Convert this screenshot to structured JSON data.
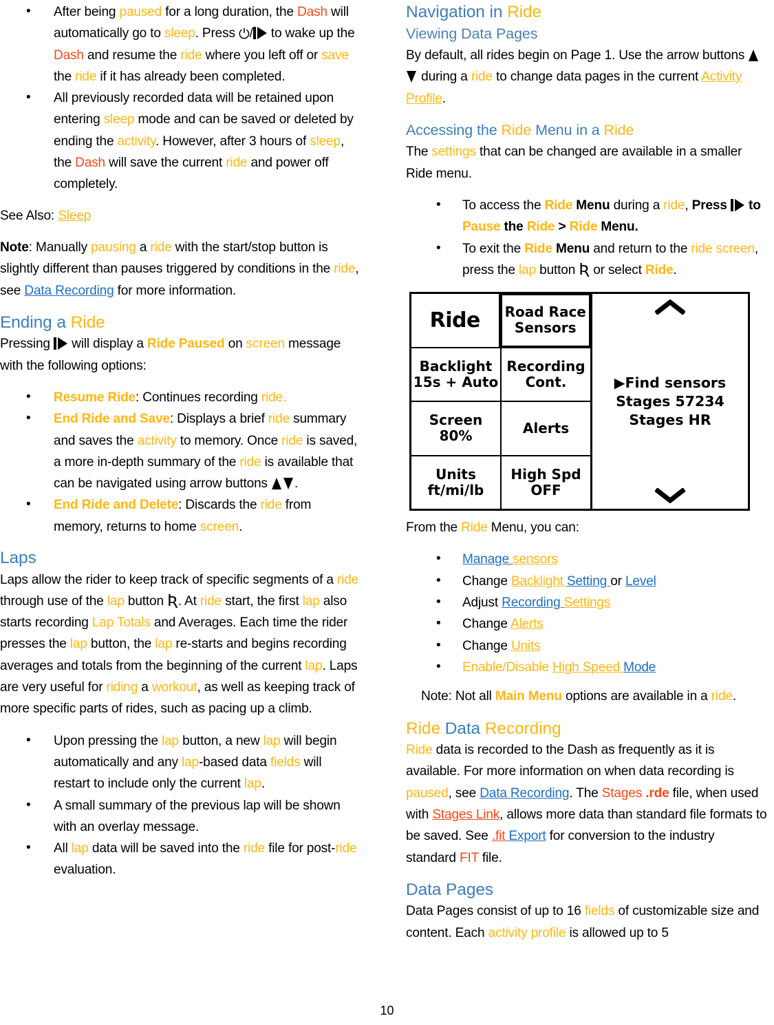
{
  "page": {
    "number": "10"
  },
  "colors": {
    "orange": "#ffb612",
    "red": "#fa4616",
    "blue_heading": "#3d7ebd",
    "blue_link": "#1f6fc4"
  },
  "left_column": {
    "bullets_top": [
      {
        "parts": [
          {
            "t": "After being ",
            "s": "plain"
          },
          {
            "t": "paused",
            "s": "orange"
          },
          {
            "t": " for a long duration, the ",
            "s": "plain"
          },
          {
            "t": "Dash",
            "s": "red"
          },
          {
            "t": " will automatically go to ",
            "s": "plain"
          },
          {
            "t": "sleep",
            "s": "orange"
          },
          {
            "t": ". Press ",
            "s": "plain"
          },
          {
            "t": "[power]/[playpause]",
            "s": "icon"
          },
          {
            "t": " to wake up the ",
            "s": "plain"
          },
          {
            "t": "Dash",
            "s": "red"
          },
          {
            "t": " and resume the ",
            "s": "plain"
          },
          {
            "t": "ride",
            "s": "orange"
          },
          {
            "t": " where you left off or ",
            "s": "plain"
          },
          {
            "t": "save",
            "s": "orange"
          },
          {
            "t": " the ",
            "s": "plain"
          },
          {
            "t": "ride",
            "s": "orange"
          },
          {
            "t": " if it has already been completed.",
            "s": "plain"
          }
        ]
      },
      {
        "parts": [
          {
            "t": "All previously recorded data will be retained upon entering ",
            "s": "plain"
          },
          {
            "t": "sleep",
            "s": "orange"
          },
          {
            "t": " mode and can be saved or deleted by ending the ",
            "s": "plain"
          },
          {
            "t": "activity",
            "s": "orange"
          },
          {
            "t": ". However, after 3 hours of ",
            "s": "plain"
          },
          {
            "t": "sleep",
            "s": "orange"
          },
          {
            "t": ", the ",
            "s": "plain"
          },
          {
            "t": "Dash",
            "s": "red"
          },
          {
            "t": " will save the current ",
            "s": "plain"
          },
          {
            "t": "ride",
            "s": "orange"
          },
          {
            "t": " and power off completely.",
            "s": "plain"
          }
        ]
      }
    ],
    "see_also_prefix": "See Also: ",
    "see_also_link": "Sleep",
    "note_label": "Note",
    "note_text_1": ": Manually ",
    "note_pausing": "pausing",
    "note_text_2": " a ",
    "note_ride": "ride",
    "note_text_3": " with the start/stop button is slightly different than pauses triggered by conditions in the ",
    "note_ride2": "ride",
    "note_text_4": ", see ",
    "note_link": "Data Recording",
    "note_text_5": " for more information.",
    "ending_heading_a": "Ending a ",
    "ending_heading_b": "Ride",
    "ending_text_1": "Pressing ",
    "ending_text_2": " will display a ",
    "ending_bold": "Ride Paused",
    "ending_text_3": " on ",
    "ending_screen": "screen",
    "ending_text_4": " message with the following options:",
    "ending_bullets": [
      {
        "bold_label": "Resume Ride",
        "parts": [
          {
            "t": ": Continues recording ",
            "s": "plain"
          },
          {
            "t": "ride.",
            "s": "orange"
          }
        ]
      },
      {
        "bold_label": "End Ride and Save",
        "parts": [
          {
            "t": ": Displays a brief ",
            "s": "plain"
          },
          {
            "t": "ride",
            "s": "orange"
          },
          {
            "t": " summary and saves the ",
            "s": "plain"
          },
          {
            "t": "activity",
            "s": "orange"
          },
          {
            "t": " to memory. Once ",
            "s": "plain"
          },
          {
            "t": "ride",
            "s": "orange"
          },
          {
            "t": " is saved, a more in-depth summary of the ",
            "s": "plain"
          },
          {
            "t": "ride",
            "s": "orange"
          },
          {
            "t": " is available that can be navigated using arrow buttons ",
            "s": "plain"
          },
          {
            "t": "[up][down]",
            "s": "icon"
          },
          {
            "t": ".",
            "s": "plain"
          }
        ]
      },
      {
        "bold_label": "End Ride and Delete",
        "parts": [
          {
            "t": ": Discards the ",
            "s": "plain"
          },
          {
            "t": "ride",
            "s": "orange"
          },
          {
            "t": " from memory, returns to home ",
            "s": "plain"
          },
          {
            "t": "screen",
            "s": "orange"
          },
          {
            "t": ".",
            "s": "plain"
          }
        ]
      }
    ],
    "laps_heading": "Laps",
    "laps_paragraph": [
      {
        "t": "Laps allow the rider to keep track of specific segments of a ",
        "s": "plain"
      },
      {
        "t": "ride",
        "s": "orange"
      },
      {
        "t": " through use of the ",
        "s": "plain"
      },
      {
        "t": "lap",
        "s": "orange"
      },
      {
        "t": " button ",
        "s": "plain"
      },
      {
        "t": "[lap]",
        "s": "icon"
      },
      {
        "t": ". At ",
        "s": "plain"
      },
      {
        "t": "ride",
        "s": "orange"
      },
      {
        "t": " start, the first ",
        "s": "plain"
      },
      {
        "t": "lap",
        "s": "orange"
      },
      {
        "t": " also starts recording ",
        "s": "plain"
      },
      {
        "t": "Lap Totals",
        "s": "orange"
      },
      {
        "t": " and Averages. Each time the rider presses the ",
        "s": "plain"
      },
      {
        "t": "lap",
        "s": "orange"
      },
      {
        "t": " button, the ",
        "s": "plain"
      },
      {
        "t": "lap",
        "s": "orange"
      },
      {
        "t": " re-starts and begins recording averages and totals from the beginning of the current ",
        "s": "plain"
      },
      {
        "t": "lap",
        "s": "orange"
      },
      {
        "t": ". Laps are very useful for ",
        "s": "plain"
      },
      {
        "t": "riding",
        "s": "orange"
      },
      {
        "t": " a ",
        "s": "plain"
      },
      {
        "t": "workout",
        "s": "orange"
      },
      {
        "t": ", as well as keeping track of more specific parts of rides, such as pacing up a climb.",
        "s": "plain"
      }
    ],
    "laps_bullets": [
      {
        "parts": [
          {
            "t": "Upon pressing the ",
            "s": "plain"
          },
          {
            "t": "lap",
            "s": "orange"
          },
          {
            "t": " button, a new ",
            "s": "plain"
          },
          {
            "t": "lap",
            "s": "orange"
          },
          {
            "t": " will begin automatically and any ",
            "s": "plain"
          },
          {
            "t": "lap",
            "s": "orange"
          },
          {
            "t": "-based data ",
            "s": "plain"
          },
          {
            "t": "fields",
            "s": "orange"
          },
          {
            "t": " will restart to include only the current ",
            "s": "plain"
          },
          {
            "t": "lap",
            "s": "orange"
          },
          {
            "t": ".",
            "s": "plain"
          }
        ]
      },
      {
        "parts": [
          {
            "t": "A small summary of the previous lap will be shown with an overlay message.",
            "s": "plain"
          }
        ]
      },
      {
        "parts": [
          {
            "t": "All ",
            "s": "plain"
          },
          {
            "t": "lap",
            "s": "orange"
          },
          {
            "t": " data will be saved into the ",
            "s": "plain"
          },
          {
            "t": "ride",
            "s": "orange"
          },
          {
            "t": " file for post-",
            "s": "plain"
          },
          {
            "t": "ride",
            "s": "orange"
          },
          {
            "t": " evaluation.",
            "s": "plain"
          }
        ]
      }
    ]
  },
  "right_column": {
    "nav_heading_a": "Navigation in ",
    "nav_heading_b": "Ride",
    "viewing_heading": "Viewing Data Pages",
    "viewing_text_1": "By default, all rides begin on Page 1. Use the arrow buttons ",
    "viewing_text_2": " during a ",
    "viewing_ride": "ride",
    "viewing_text_3": " to change data pages in the current ",
    "viewing_link": "Activity Profile",
    "viewing_text_4": ".",
    "accessing_heading": [
      {
        "t": "Accessing the ",
        "s": "blue"
      },
      {
        "t": "Ride",
        "s": "orange"
      },
      {
        "t": " Menu in a ",
        "s": "blue"
      },
      {
        "t": "Ride",
        "s": "orange"
      }
    ],
    "accessing_text_1": "The ",
    "accessing_settings": "settings",
    "accessing_text_2": " that can be changed are available in a smaller Ride menu.",
    "access_bullets": [
      {
        "parts": [
          {
            "t": "To access the ",
            "s": "plain"
          },
          {
            "t": "Ride",
            "s": "orange-bold"
          },
          {
            "t": " Menu",
            "s": "bold"
          },
          {
            "t": " during a ",
            "s": "plain"
          },
          {
            "t": "ride",
            "s": "orange"
          },
          {
            "t": ", ",
            "s": "plain"
          },
          {
            "t": "Press ",
            "s": "bold"
          },
          {
            "t": "[playpause]",
            "s": "icon"
          },
          {
            "t": " to ",
            "s": "bold"
          },
          {
            "t": "Pause",
            "s": "orange-bold"
          },
          {
            "t": " the ",
            "s": "bold"
          },
          {
            "t": "Ride",
            "s": "orange-bold"
          },
          {
            "t": " > ",
            "s": "bold"
          },
          {
            "t": "Ride",
            "s": "orange-bold"
          },
          {
            "t": " Menu.",
            "s": "bold"
          }
        ]
      },
      {
        "parts": [
          {
            "t": "To exit the ",
            "s": "plain"
          },
          {
            "t": "Ride",
            "s": "orange-bold"
          },
          {
            "t": " Menu",
            "s": "bold"
          },
          {
            "t": " and return to the ",
            "s": "plain"
          },
          {
            "t": "ride screen",
            "s": "orange"
          },
          {
            "t": ", press the ",
            "s": "plain"
          },
          {
            "t": "lap",
            "s": "orange"
          },
          {
            "t": " button ",
            "s": "plain"
          },
          {
            "t": "[lap]",
            "s": "icon"
          },
          {
            "t": " or select ",
            "s": "plain"
          },
          {
            "t": "Ride",
            "s": "orange-bold"
          },
          {
            "t": ".",
            "s": "plain"
          }
        ]
      }
    ],
    "device_screen": {
      "rows": [
        [
          {
            "label": "Ride",
            "value": "",
            "selected": false,
            "title": true
          },
          {
            "label": "Road Race",
            "value": "Sensors",
            "selected": true,
            "title": false
          }
        ],
        [
          {
            "label": "Backlight",
            "value": "15s + Auto",
            "selected": false,
            "title": false
          },
          {
            "label": "Recording",
            "value": "Cont.",
            "selected": false,
            "title": false
          }
        ],
        [
          {
            "label": "Screen",
            "value": "80%",
            "selected": false,
            "title": false
          },
          {
            "label": "Alerts",
            "value": "",
            "selected": false,
            "title": false
          }
        ],
        [
          {
            "label": "Units",
            "value": "ft/mi/lb",
            "selected": false,
            "title": false
          },
          {
            "label": "High Spd",
            "value": "OFF",
            "selected": false,
            "title": false
          }
        ]
      ],
      "panel_lines": [
        "▶Find sensors",
        "Stages 57234",
        "Stages HR"
      ],
      "scroll_up_icon": "chevron-up-icon",
      "scroll_down_icon": "chevron-down-icon"
    },
    "from_menu_text_1": "From the ",
    "from_menu_ride": "Ride",
    "from_menu_text_2": " Menu, you can:",
    "menu_bullets": [
      {
        "parts": [
          {
            "t": "Manage ",
            "s": "link-blue"
          },
          {
            "t": "sensors",
            "s": "link-orange"
          }
        ]
      },
      {
        "parts": [
          {
            "t": "Change ",
            "s": "plain"
          },
          {
            "t": "Backlight ",
            "s": "link-orange"
          },
          {
            "t": "Setting ",
            "s": "link-blue"
          },
          {
            "t": "or ",
            "s": "plain"
          },
          {
            "t": "Level",
            "s": "link-blue"
          }
        ]
      },
      {
        "parts": [
          {
            "t": "Adjust ",
            "s": "plain"
          },
          {
            "t": "Recording ",
            "s": "link-blue"
          },
          {
            "t": "Settings",
            "s": "link-orange"
          }
        ]
      },
      {
        "parts": [
          {
            "t": "Change ",
            "s": "plain"
          },
          {
            "t": "Alerts",
            "s": "link-orange"
          }
        ]
      },
      {
        "parts": [
          {
            "t": "Change ",
            "s": "plain"
          },
          {
            "t": "Units",
            "s": "link-orange"
          }
        ]
      },
      {
        "parts": [
          {
            "t": "Enable/Disable ",
            "s": "orange"
          },
          {
            "t": "High Speed ",
            "s": "link-orange"
          },
          {
            "t": "Mode",
            "s": "link-blue"
          }
        ]
      }
    ],
    "note_text_1": "Note: Not all ",
    "note_bold": "Main Menu",
    "note_text_2": " options are available in a ",
    "note_ride": "ride",
    "note_text_3": ".",
    "rdr_heading": [
      {
        "t": "Ride",
        "s": "orange"
      },
      {
        "t": " Data ",
        "s": "blue"
      },
      {
        "t": "Recording",
        "s": "orange"
      }
    ],
    "rdr_paragraph": [
      {
        "t": "Ride",
        "s": "orange"
      },
      {
        "t": " data is recorded to the Dash as frequently as it is available. For more information on when data recording is ",
        "s": "plain"
      },
      {
        "t": "paused",
        "s": "orange"
      },
      {
        "t": ", see ",
        "s": "plain"
      },
      {
        "t": "Data Recording",
        "s": "link-blue"
      },
      {
        "t": ". The ",
        "s": "plain"
      },
      {
        "t": "Stages ",
        "s": "red"
      },
      {
        "t": ".rde",
        "s": "red-bold"
      },
      {
        "t": " file, when used with ",
        "s": "plain"
      },
      {
        "t": "Stages Link",
        "s": "link-red"
      },
      {
        "t": ", allows more data than standard file formats to be saved. See ",
        "s": "plain"
      },
      {
        "t": ".fit ",
        "s": "link-red"
      },
      {
        "t": "Export",
        "s": "link-blue"
      },
      {
        "t": " for conversion to the industry standard ",
        "s": "plain"
      },
      {
        "t": "FIT",
        "s": "red"
      },
      {
        "t": " file.",
        "s": "plain"
      }
    ],
    "datapages_heading": "Data Pages",
    "datapages_paragraph": [
      {
        "t": "Data Pages consist of up to 16 ",
        "s": "plain"
      },
      {
        "t": "fields",
        "s": "orange"
      },
      {
        "t": " of customizable size and content. Each ",
        "s": "plain"
      },
      {
        "t": "activity profile",
        "s": "orange"
      },
      {
        "t": " is allowed up to 5",
        "s": "plain"
      }
    ]
  }
}
